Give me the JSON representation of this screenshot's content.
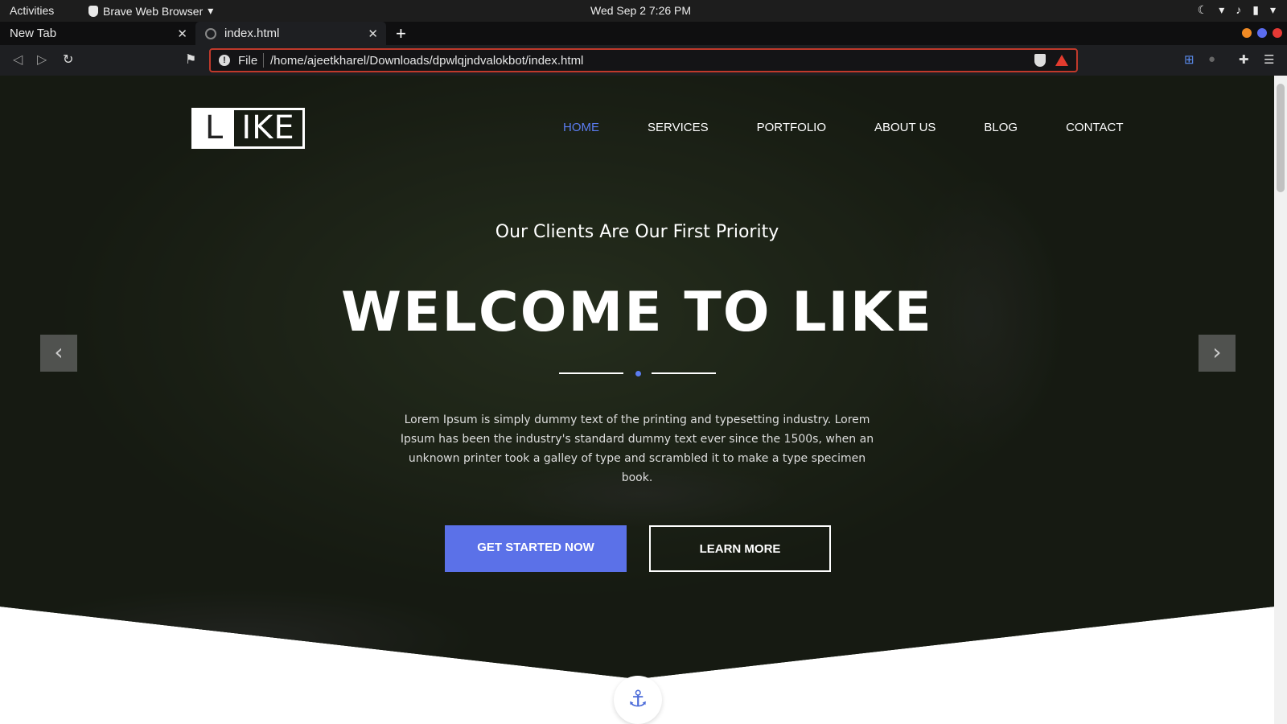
{
  "system": {
    "activities": "Activities",
    "app_menu": "Brave Web Browser",
    "clock": "Wed Sep 2  7:26 PM"
  },
  "browser": {
    "tabs": [
      {
        "label": "New Tab"
      },
      {
        "label": "index.html"
      }
    ],
    "new_tab_symbol": "+",
    "address": {
      "scheme_label": "File",
      "url": "/home/ajeetkharel/Downloads/dpwlqjndvalokbot/index.html"
    },
    "colors": {
      "url_border": "#c0392b",
      "dot_orange": "#f08a24",
      "dot_blue": "#5b6cf0",
      "dot_red": "#e53935"
    }
  },
  "site": {
    "logo": {
      "first": "L",
      "rest": "IKE"
    },
    "nav": [
      {
        "label": "HOME",
        "active": true
      },
      {
        "label": "SERVICES"
      },
      {
        "label": "PORTFOLIO"
      },
      {
        "label": "ABOUT US"
      },
      {
        "label": "BLOG"
      },
      {
        "label": "CONTACT"
      }
    ],
    "hero": {
      "subtitle": "Our Clients Are Our First Priority",
      "title": "WELCOME TO LIKE",
      "lead": "Lorem Ipsum is simply dummy text of the printing and typesetting industry. Lorem Ipsum has been the industry's standard dummy text ever since the 1500s, when an unknown printer took a galley of type and scrambled it to make a type specimen book.",
      "primary_button": "GET STARTED NOW",
      "secondary_button": "LEARN MORE"
    },
    "accent_color": "#5b71e8"
  }
}
